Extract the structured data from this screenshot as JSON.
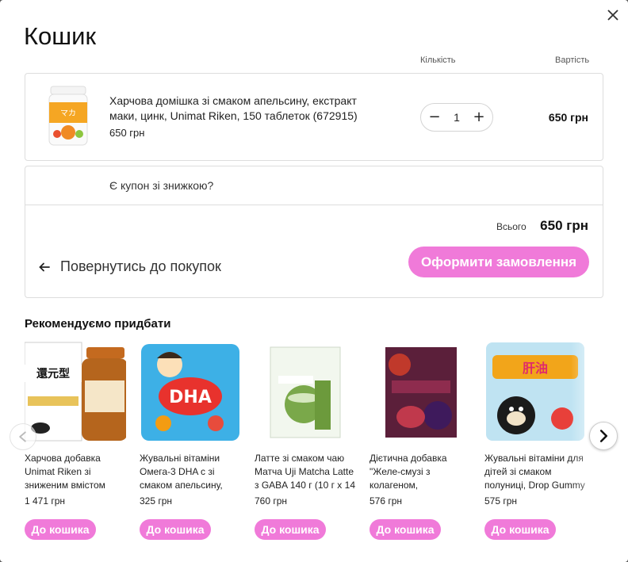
{
  "cart": {
    "title": "Кошик",
    "col_quantity": "Кількість",
    "col_value": "Вартість",
    "item": {
      "name": "Харчова домішка зі смаком апельсину, екстракт маки, цинк, Unimat Riken, 150 таблеток (672915)",
      "price": "650 грн",
      "quantity": "1",
      "total": "650 грн"
    },
    "coupon_text": "Є купон зі знижкою?",
    "total_label": "Всього",
    "total_value": "650 грн",
    "back_label": "Повернутись до покупок",
    "checkout_label": "Оформити замовлення"
  },
  "recommendations": {
    "title": "Рекомендуємо придбати",
    "items": [
      {
        "name": "Харчова добавка Unimat Riken зі зниженим вмістом",
        "price": "1 471 грн",
        "button": "До кошика"
      },
      {
        "name": "Жувальні вітаміни Омега-3 DHA с зі смаком апельсину,",
        "price": "325 грн",
        "button": "До кошика"
      },
      {
        "name": "Латте зі смаком чаю Матча Uji Matcha Latte з GABA 140 г (10 г х 14",
        "price": "760 грн",
        "button": "До кошика"
      },
      {
        "name": "Дієтична добавка \"Желе-смузі з колагеном,",
        "price": "576 грн",
        "button": "До кошика"
      },
      {
        "name": "Жувальні вітаміни для дітей зі смаком полуниці, Drop Gummy",
        "price": "575 грн",
        "button": "До кошика"
      }
    ]
  },
  "icons": {
    "close": "close-icon",
    "minus": "minus-icon",
    "plus": "plus-icon",
    "back": "arrow-left-icon",
    "next": "chevron-right-icon",
    "prev": "chevron-left-icon"
  },
  "colors": {
    "accent": "#f07ad9"
  }
}
